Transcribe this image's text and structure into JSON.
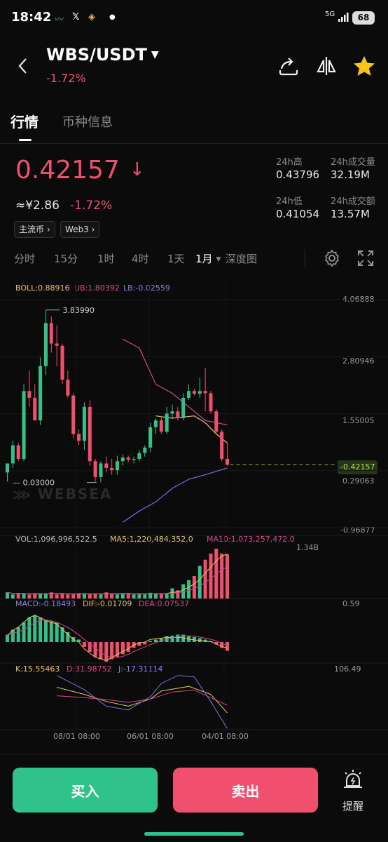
{
  "status_bar": {
    "time": "18:42",
    "network": "5G",
    "battery": "68"
  },
  "header": {
    "pair": "WBS/USDT",
    "change": "-1.72%"
  },
  "tabs": [
    {
      "label": "行情"
    },
    {
      "label": "币种信息"
    }
  ],
  "ticker": {
    "price": "0.42157",
    "cny_price": "≈¥2.86",
    "cny_change": "-1.72%",
    "tags": [
      "主流币",
      "Web3"
    ],
    "high_label": "24h高",
    "high": "0.43796",
    "vol_label": "24h成交量",
    "vol": "32.19M",
    "low_label": "24h低",
    "low": "0.41054",
    "amount_label": "24h成交额",
    "amount": "13.57M"
  },
  "periods": [
    "分时",
    "15分",
    "1时",
    "4时",
    "1天",
    "1月",
    "深度图"
  ],
  "active_period": "1月",
  "indicators": {
    "boll": "BOLL:0.88916",
    "ub": "UB:1.80392",
    "lb": "LB:-0.02559",
    "vol": "VOL:1,096,996,522.5",
    "ma5": "MA5:1,220,484,352.0",
    "ma10": "MA10:1,073,257,472.0",
    "macd": "MACD:-0.18493",
    "dif": "DIF:-0.01709",
    "dea": "DEA:0.07537",
    "k": "K:15.55463",
    "d": "D:31.98752",
    "j": "J:-17.31114"
  },
  "axis": {
    "price_ticks": [
      "4.06888",
      "2.80946",
      "1.55005",
      "0.29063",
      "-0.96877"
    ],
    "current_price_tag": "0.42157",
    "max_marker": "3.83990",
    "min_marker": "0.03000",
    "vol_max": "1.34B",
    "macd_max": "0.59",
    "kdj_max": "106.49",
    "dates": [
      "08/01 08:00",
      "06/01 08:00",
      "04/01 08:00"
    ]
  },
  "watermark": "WEBSEA",
  "colors": {
    "up": "#2fc28a",
    "down": "#f0506e",
    "boll_mid": "#e8c25a",
    "boll_ub": "#d0488f",
    "boll_lb": "#7a6fe0"
  },
  "chart_data": {
    "type": "candlestick",
    "candles": [
      {
        "o": 0.25,
        "h": 0.45,
        "l": 0.05,
        "c": 0.45
      },
      {
        "o": 0.45,
        "h": 0.95,
        "l": 0.35,
        "c": 0.85
      },
      {
        "o": 0.85,
        "h": 0.9,
        "l": 0.5,
        "c": 0.55
      },
      {
        "o": 0.55,
        "h": 2.2,
        "l": 0.5,
        "c": 2.05
      },
      {
        "o": 2.05,
        "h": 2.5,
        "l": 1.7,
        "c": 1.9
      },
      {
        "o": 1.9,
        "h": 2.2,
        "l": 1.4,
        "c": 1.4
      },
      {
        "o": 1.4,
        "h": 2.8,
        "l": 1.3,
        "c": 2.6
      },
      {
        "o": 2.6,
        "h": 3.84,
        "l": 2.4,
        "c": 3.55
      },
      {
        "o": 3.55,
        "h": 3.7,
        "l": 2.9,
        "c": 3.1
      },
      {
        "o": 3.1,
        "h": 3.5,
        "l": 2.6,
        "c": 3.05
      },
      {
        "o": 3.05,
        "h": 3.1,
        "l": 2.2,
        "c": 2.3
      },
      {
        "o": 2.3,
        "h": 2.5,
        "l": 1.9,
        "c": 1.95
      },
      {
        "o": 1.95,
        "h": 2.0,
        "l": 1.0,
        "c": 1.1
      },
      {
        "o": 1.1,
        "h": 1.2,
        "l": 0.85,
        "c": 0.95
      },
      {
        "o": 0.95,
        "h": 1.8,
        "l": 0.75,
        "c": 1.7
      },
      {
        "o": 1.7,
        "h": 1.85,
        "l": 0.4,
        "c": 0.5
      },
      {
        "o": 0.5,
        "h": 0.55,
        "l": 0.05,
        "c": 0.15
      },
      {
        "o": 0.15,
        "h": 0.5,
        "l": 0.03,
        "c": 0.45
      },
      {
        "o": 0.45,
        "h": 0.6,
        "l": 0.25,
        "c": 0.35
      },
      {
        "o": 0.35,
        "h": 0.55,
        "l": 0.2,
        "c": 0.3
      },
      {
        "o": 0.3,
        "h": 0.62,
        "l": 0.2,
        "c": 0.5
      },
      {
        "o": 0.5,
        "h": 0.65,
        "l": 0.4,
        "c": 0.58
      },
      {
        "o": 0.58,
        "h": 0.62,
        "l": 0.48,
        "c": 0.53
      },
      {
        "o": 0.53,
        "h": 0.6,
        "l": 0.45,
        "c": 0.55
      },
      {
        "o": 0.55,
        "h": 0.75,
        "l": 0.5,
        "c": 0.68
      },
      {
        "o": 0.68,
        "h": 0.85,
        "l": 0.6,
        "c": 0.8
      },
      {
        "o": 0.8,
        "h": 1.35,
        "l": 0.7,
        "c": 1.25
      },
      {
        "o": 1.25,
        "h": 1.45,
        "l": 1.1,
        "c": 1.4
      },
      {
        "o": 1.4,
        "h": 1.5,
        "l": 1.1,
        "c": 1.15
      },
      {
        "o": 1.15,
        "h": 1.7,
        "l": 1.1,
        "c": 1.55
      },
      {
        "o": 1.55,
        "h": 1.75,
        "l": 1.45,
        "c": 1.6
      },
      {
        "o": 1.6,
        "h": 1.7,
        "l": 1.4,
        "c": 1.45
      },
      {
        "o": 1.45,
        "h": 2.0,
        "l": 1.4,
        "c": 1.9
      },
      {
        "o": 1.9,
        "h": 2.2,
        "l": 1.85,
        "c": 2.05
      },
      {
        "o": 2.05,
        "h": 2.1,
        "l": 1.95,
        "c": 1.99
      },
      {
        "o": 1.99,
        "h": 2.35,
        "l": 1.9,
        "c": 2.05
      },
      {
        "o": 2.05,
        "h": 2.55,
        "l": 1.6,
        "c": 2.0
      },
      {
        "o": 2.0,
        "h": 2.05,
        "l": 1.55,
        "c": 1.6
      },
      {
        "o": 1.6,
        "h": 1.65,
        "l": 1.1,
        "c": 1.15
      },
      {
        "o": 1.15,
        "h": 1.2,
        "l": 0.5,
        "c": 0.55
      },
      {
        "o": 0.55,
        "h": 0.9,
        "l": 0.4,
        "c": 0.42157
      }
    ],
    "price_range": [
      -0.96877,
      4.06888
    ],
    "boll_ub": [
      [
        21,
        3.2
      ],
      [
        24,
        3.0
      ],
      [
        27,
        2.2
      ],
      [
        30,
        2.0
      ],
      [
        33,
        1.7
      ],
      [
        36,
        1.4
      ],
      [
        40,
        1.3
      ]
    ],
    "boll_mid": [
      [
        27,
        1.5
      ],
      [
        30,
        1.45
      ],
      [
        34,
        1.5
      ],
      [
        36,
        1.35
      ],
      [
        38,
        1.1
      ],
      [
        40,
        0.9
      ]
    ],
    "boll_lb": [
      [
        21,
        -0.85
      ],
      [
        24,
        -0.6
      ],
      [
        27,
        -0.4
      ],
      [
        30,
        -0.1
      ],
      [
        33,
        0.1
      ],
      [
        36,
        0.2
      ],
      [
        40,
        0.35
      ]
    ],
    "volume": [
      0.15,
      0.1,
      0.12,
      0.12,
      0.1,
      0.13,
      0.12,
      0.12,
      0.15,
      0.1,
      0.12,
      0.1,
      0.1,
      0.13,
      0.12,
      0.1,
      0.12,
      0.1,
      0.15,
      0.12,
      0.1,
      0.13,
      0.12,
      0.1,
      0.12,
      0.1,
      0.14,
      0.12,
      0.12,
      0.13,
      0.25,
      0.2,
      0.35,
      0.45,
      0.55,
      0.8,
      0.95,
      1.1,
      1.22,
      1.1,
      1.08
    ],
    "macd": [
      0.15,
      0.25,
      0.3,
      0.4,
      0.5,
      0.55,
      0.5,
      0.45,
      0.42,
      0.4,
      0.3,
      0.2,
      0.1,
      0.05,
      -0.1,
      -0.2,
      -0.3,
      -0.35,
      -0.4,
      -0.35,
      -0.3,
      -0.25,
      -0.2,
      -0.12,
      -0.08,
      -0.05,
      0.02,
      0.05,
      0.08,
      0.12,
      0.13,
      0.15,
      0.15,
      0.12,
      0.1,
      0.08,
      0.05,
      0.02,
      -0.05,
      -0.12,
      -0.18
    ],
    "kdj_k": [
      [
        9,
        70
      ],
      [
        14,
        55
      ],
      [
        18,
        40
      ],
      [
        22,
        30
      ],
      [
        26,
        45
      ],
      [
        28,
        62
      ],
      [
        33,
        72
      ],
      [
        37,
        55
      ],
      [
        40,
        15.5
      ]
    ],
    "kdj_d": [
      [
        9,
        52
      ],
      [
        14,
        48
      ],
      [
        18,
        44
      ],
      [
        22,
        38
      ],
      [
        26,
        45
      ],
      [
        30,
        60
      ],
      [
        34,
        64
      ],
      [
        37,
        48
      ],
      [
        40,
        32
      ]
    ],
    "kdj_j": [
      [
        9,
        95
      ],
      [
        14,
        65
      ],
      [
        18,
        30
      ],
      [
        22,
        22
      ],
      [
        26,
        50
      ],
      [
        28,
        78
      ],
      [
        31,
        95
      ],
      [
        34,
        92
      ],
      [
        37,
        40
      ],
      [
        40,
        -17.3
      ]
    ]
  }
}
